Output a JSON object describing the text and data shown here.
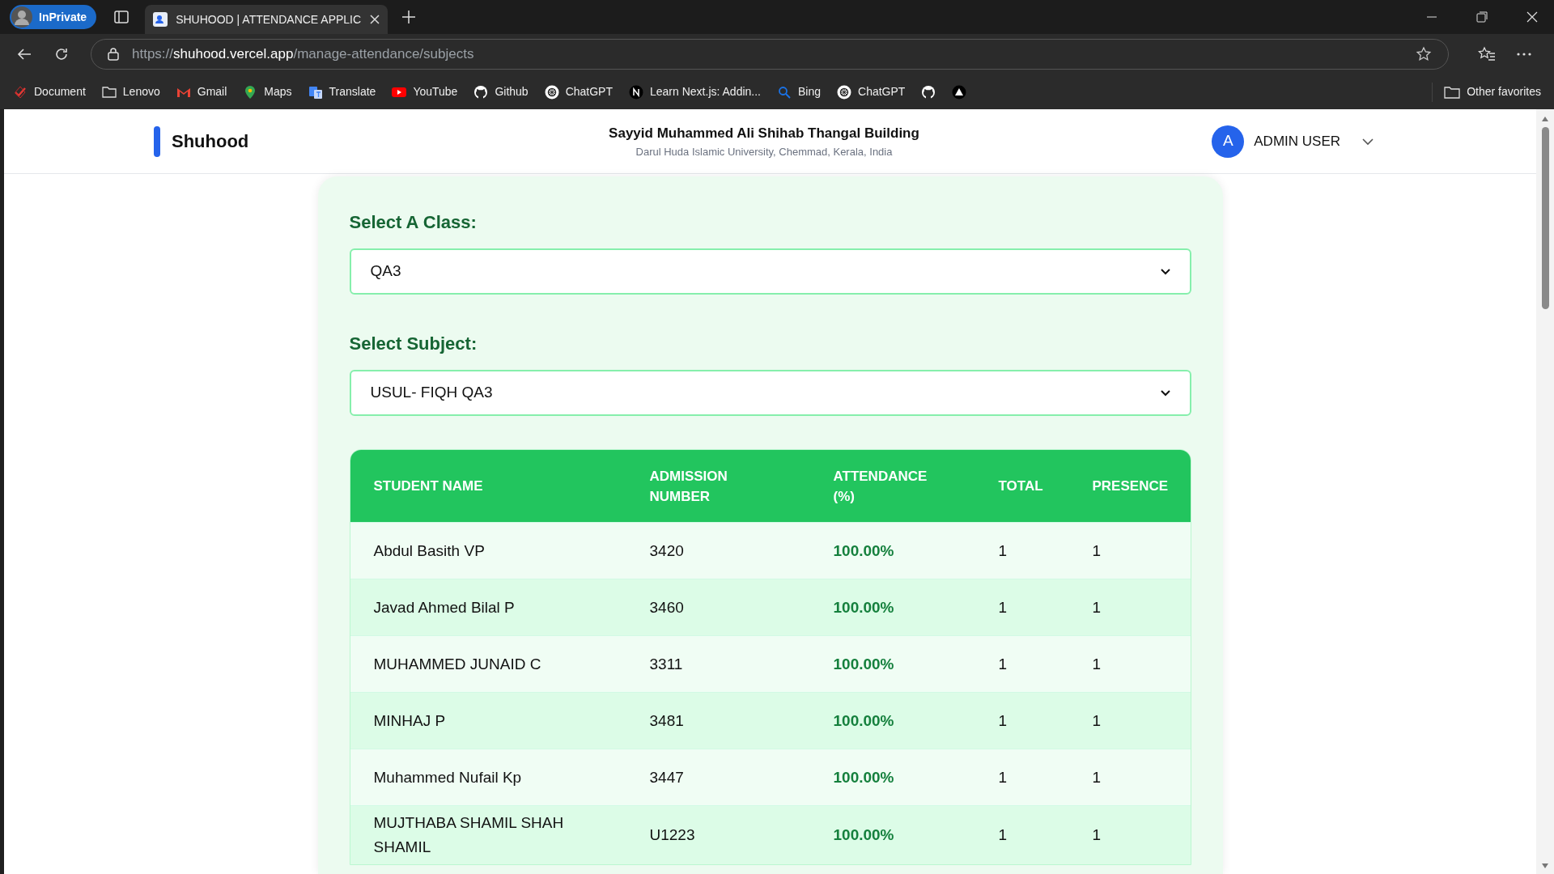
{
  "browser": {
    "profile": "InPrivate",
    "tab_title": "SHUHOOD | ATTENDANCE APPLIC",
    "url": {
      "scheme": "https://",
      "host": "shuhood.vercel.app",
      "path": "/manage-attendance/subjects"
    },
    "bookmarks": [
      {
        "kind": "labeled",
        "label": "Document"
      },
      {
        "kind": "labeled",
        "label": "Lenovo"
      },
      {
        "kind": "labeled",
        "label": "Gmail"
      },
      {
        "kind": "labeled",
        "label": "Maps"
      },
      {
        "kind": "labeled",
        "label": "Translate"
      },
      {
        "kind": "labeled",
        "label": "YouTube"
      },
      {
        "kind": "labeled",
        "label": "Github"
      },
      {
        "kind": "labeled",
        "label": "ChatGPT"
      },
      {
        "kind": "labeled",
        "label": "Learn Next.js: Addin..."
      },
      {
        "kind": "labeled",
        "label": "Bing"
      },
      {
        "kind": "labeled",
        "label": "ChatGPT"
      },
      {
        "kind": "icon_only"
      },
      {
        "kind": "icon_only"
      }
    ],
    "other_favorites": "Other favorites"
  },
  "header": {
    "brand": "Shuhood",
    "building": "Sayyid Muhammed Ali Shihab Thangal Building",
    "university": "Darul Huda Islamic University, Chemmad, Kerala, India",
    "avatar": "A",
    "user": "ADMIN USER"
  },
  "class_label": "Select A Class:",
  "class_value": "QA3",
  "subject_label": "Select Subject:",
  "subject_value": "USUL- FIQH QA3",
  "table": {
    "columns": [
      "STUDENT NAME",
      "ADMISSION NUMBER",
      "ATTENDANCE (%)",
      "TOTAL",
      "PRESENCE"
    ],
    "rows": [
      [
        "Abdul Basith VP",
        "3420",
        "100.00%",
        "1",
        "1"
      ],
      [
        "Javad Ahmed Bilal P",
        "3460",
        "100.00%",
        "1",
        "1"
      ],
      [
        "MUHAMMED JUNAID C",
        "3311",
        "100.00%",
        "1",
        "1"
      ],
      [
        "MINHAJ P",
        "3481",
        "100.00%",
        "1",
        "1"
      ],
      [
        "Muhammed Nufail Kp",
        "3447",
        "100.00%",
        "1",
        "1"
      ],
      [
        "MUJTHABA SHAMIL SHAH SHAMIL",
        "U1223",
        "100.00%",
        "1",
        "1"
      ]
    ]
  }
}
